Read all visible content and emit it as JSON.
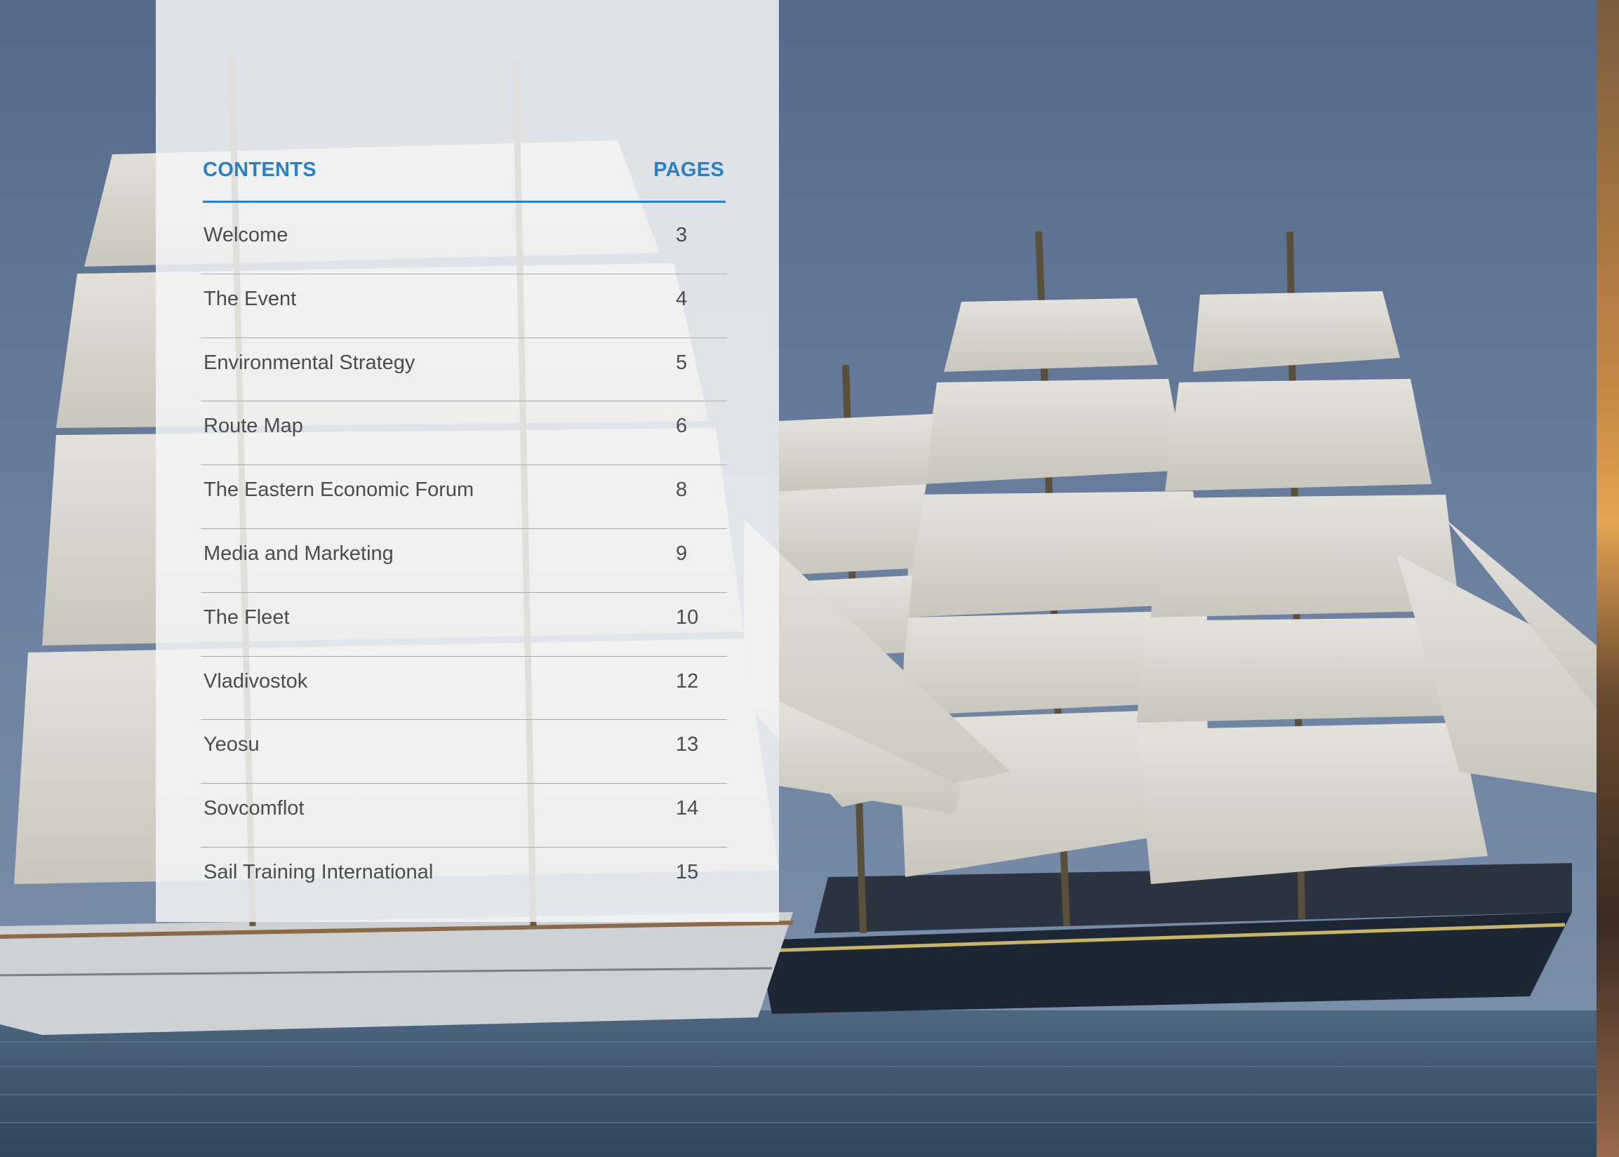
{
  "contents_panel": {
    "heading_left": "CONTENTS",
    "heading_right": "PAGES",
    "entries": [
      {
        "label": "Welcome",
        "page": "3"
      },
      {
        "label": "The Event",
        "page": "4"
      },
      {
        "label": "Environmental Strategy",
        "page": "5"
      },
      {
        "label": "Route Map",
        "page": "6"
      },
      {
        "label": "The Eastern Economic Forum",
        "page": "8"
      },
      {
        "label": "Media and Marketing",
        "page": "9"
      },
      {
        "label": "The Fleet",
        "page": "10"
      },
      {
        "label": "Vladivostok",
        "page": "12"
      },
      {
        "label": "Yeosu",
        "page": "13"
      },
      {
        "label": "Sovcomflot",
        "page": "14"
      },
      {
        "label": "Sail Training International",
        "page": "15"
      }
    ]
  },
  "colors": {
    "accent": "#2b80c3",
    "text": "#4c4c4c",
    "sky": "#5f7592",
    "sea": "#3d5366"
  }
}
